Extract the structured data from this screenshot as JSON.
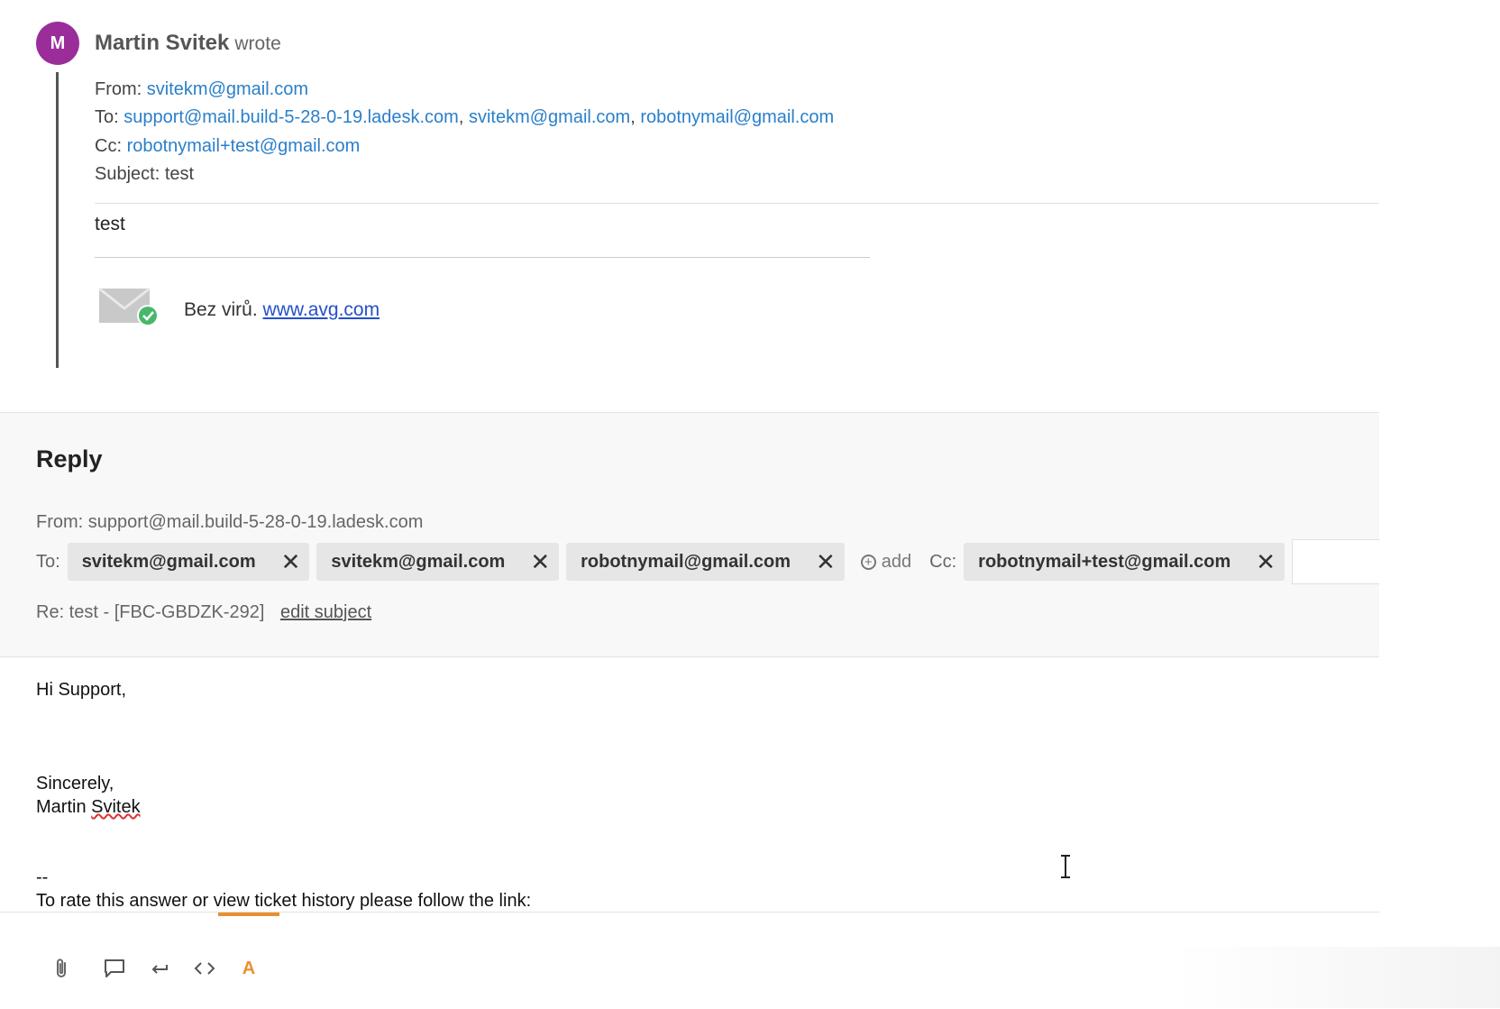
{
  "quoted": {
    "avatar_letter": "M",
    "author": "Martin Svitek",
    "wrote": "wrote",
    "from_label": "From:",
    "from": "svitekm@gmail.com",
    "to_label": "To:",
    "to": [
      "support@mail.build-5-28-0-19.ladesk.com",
      "svitekm@gmail.com",
      "robotnymail@gmail.com"
    ],
    "cc_label": "Cc:",
    "cc": "robotnymail+test@gmail.com",
    "subject_line": "Subject: test",
    "body": "test",
    "avg_text": "Bez virů.",
    "avg_link": "www.avg.com"
  },
  "reply": {
    "title": "Reply",
    "from_line": "From: support@mail.build-5-28-0-19.ladesk.com",
    "to_label": "To:",
    "to_chips": [
      "svitekm@gmail.com",
      "svitekm@gmail.com",
      "robotnymail@gmail.com"
    ],
    "add_label": "add",
    "cc_label": "Cc:",
    "cc_chips": [
      "robotnymail+test@gmail.com"
    ],
    "remove_glyph": "✕",
    "subject": "Re: test - [FBC-GBDZK-292]",
    "edit_subject": "edit subject"
  },
  "body": {
    "greeting": "Hi Support,",
    "closing": "Sincerely,",
    "signature_first": "Martin",
    "signature_last": "Svitek",
    "separator": "--",
    "rate_line": "To rate this answer or view ticket history please follow the link:"
  },
  "toolbar": {
    "format_glyph": "A",
    "accent_color": "#e89030"
  },
  "colors": {
    "avatar": "#9b2d9b",
    "link": "#2a7fc9"
  }
}
